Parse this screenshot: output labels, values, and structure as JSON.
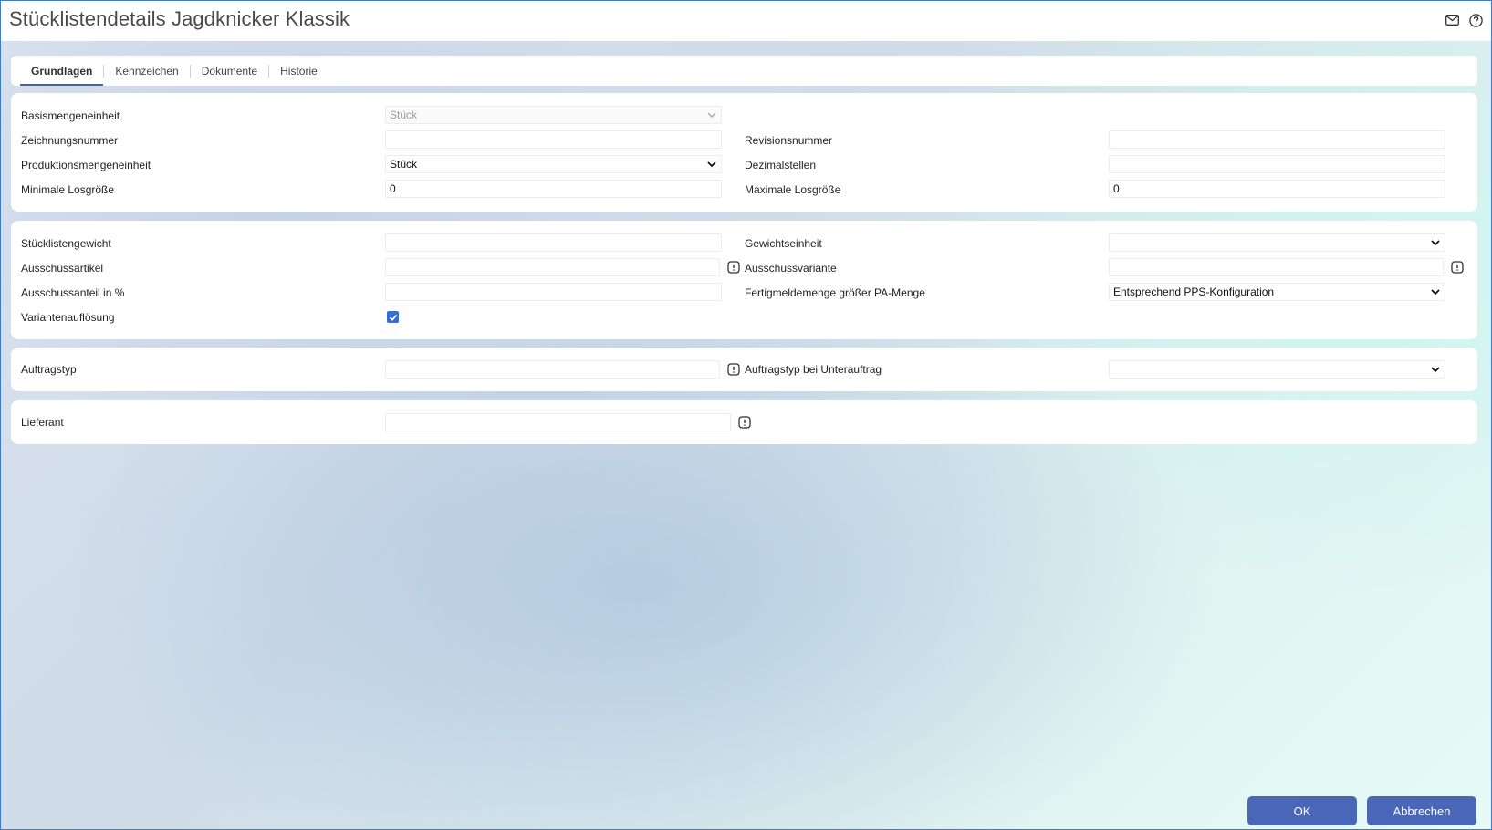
{
  "window": {
    "title": "Stücklistendetails Jagdknicker Klassik"
  },
  "title_icons": [
    "mail-icon",
    "help-icon"
  ],
  "tabs": [
    {
      "label": "Grundlagen",
      "active": true
    },
    {
      "label": "Kennzeichen",
      "active": false
    },
    {
      "label": "Dokumente",
      "active": false
    },
    {
      "label": "Historie",
      "active": false
    }
  ],
  "section1": {
    "basismengeneinheit": {
      "label": "Basismengeneinheit",
      "value": "Stück"
    },
    "zeichnungsnummer": {
      "label": "Zeichnungsnummer",
      "value": ""
    },
    "revisionsnummer": {
      "label": "Revisionsnummer",
      "value": ""
    },
    "produktionsmengeneinheit": {
      "label": "Produktionsmengeneinheit",
      "value": "Stück"
    },
    "dezimalstellen": {
      "label": "Dezimalstellen",
      "value": ""
    },
    "minimale_losgroesse": {
      "label": "Minimale Losgröße",
      "value": "0"
    },
    "maximale_losgroesse": {
      "label": "Maximale Losgröße",
      "value": "0"
    }
  },
  "section2": {
    "stuecklistengewicht": {
      "label": "Stücklistengewicht",
      "value": ""
    },
    "gewichtseinheit": {
      "label": "Gewichtseinheit",
      "value": ""
    },
    "ausschussartikel": {
      "label": "Ausschussartikel",
      "value": ""
    },
    "ausschussvariante": {
      "label": "Ausschussvariante",
      "value": ""
    },
    "ausschussanteil": {
      "label": "Ausschussanteil in %",
      "value": ""
    },
    "fertigmeldemenge": {
      "label": "Fertigmeldemenge größer PA-Menge",
      "value": "Entsprechend PPS-Konfiguration"
    },
    "variantenaufloesung": {
      "label": "Variantenauflösung",
      "checked": true
    }
  },
  "section3": {
    "auftragstyp": {
      "label": "Auftragstyp",
      "value": ""
    },
    "auftragstyp_unterauftrag": {
      "label": "Auftragstyp bei Unterauftrag",
      "value": ""
    }
  },
  "section4": {
    "lieferant": {
      "label": "Lieferant",
      "value": ""
    }
  },
  "buttons": {
    "ok": "OK",
    "cancel": "Abbrechen"
  },
  "colors": {
    "accent": "#4a66b6",
    "checkbox": "#2f6fe0",
    "tab_underline": "#4a6591"
  }
}
